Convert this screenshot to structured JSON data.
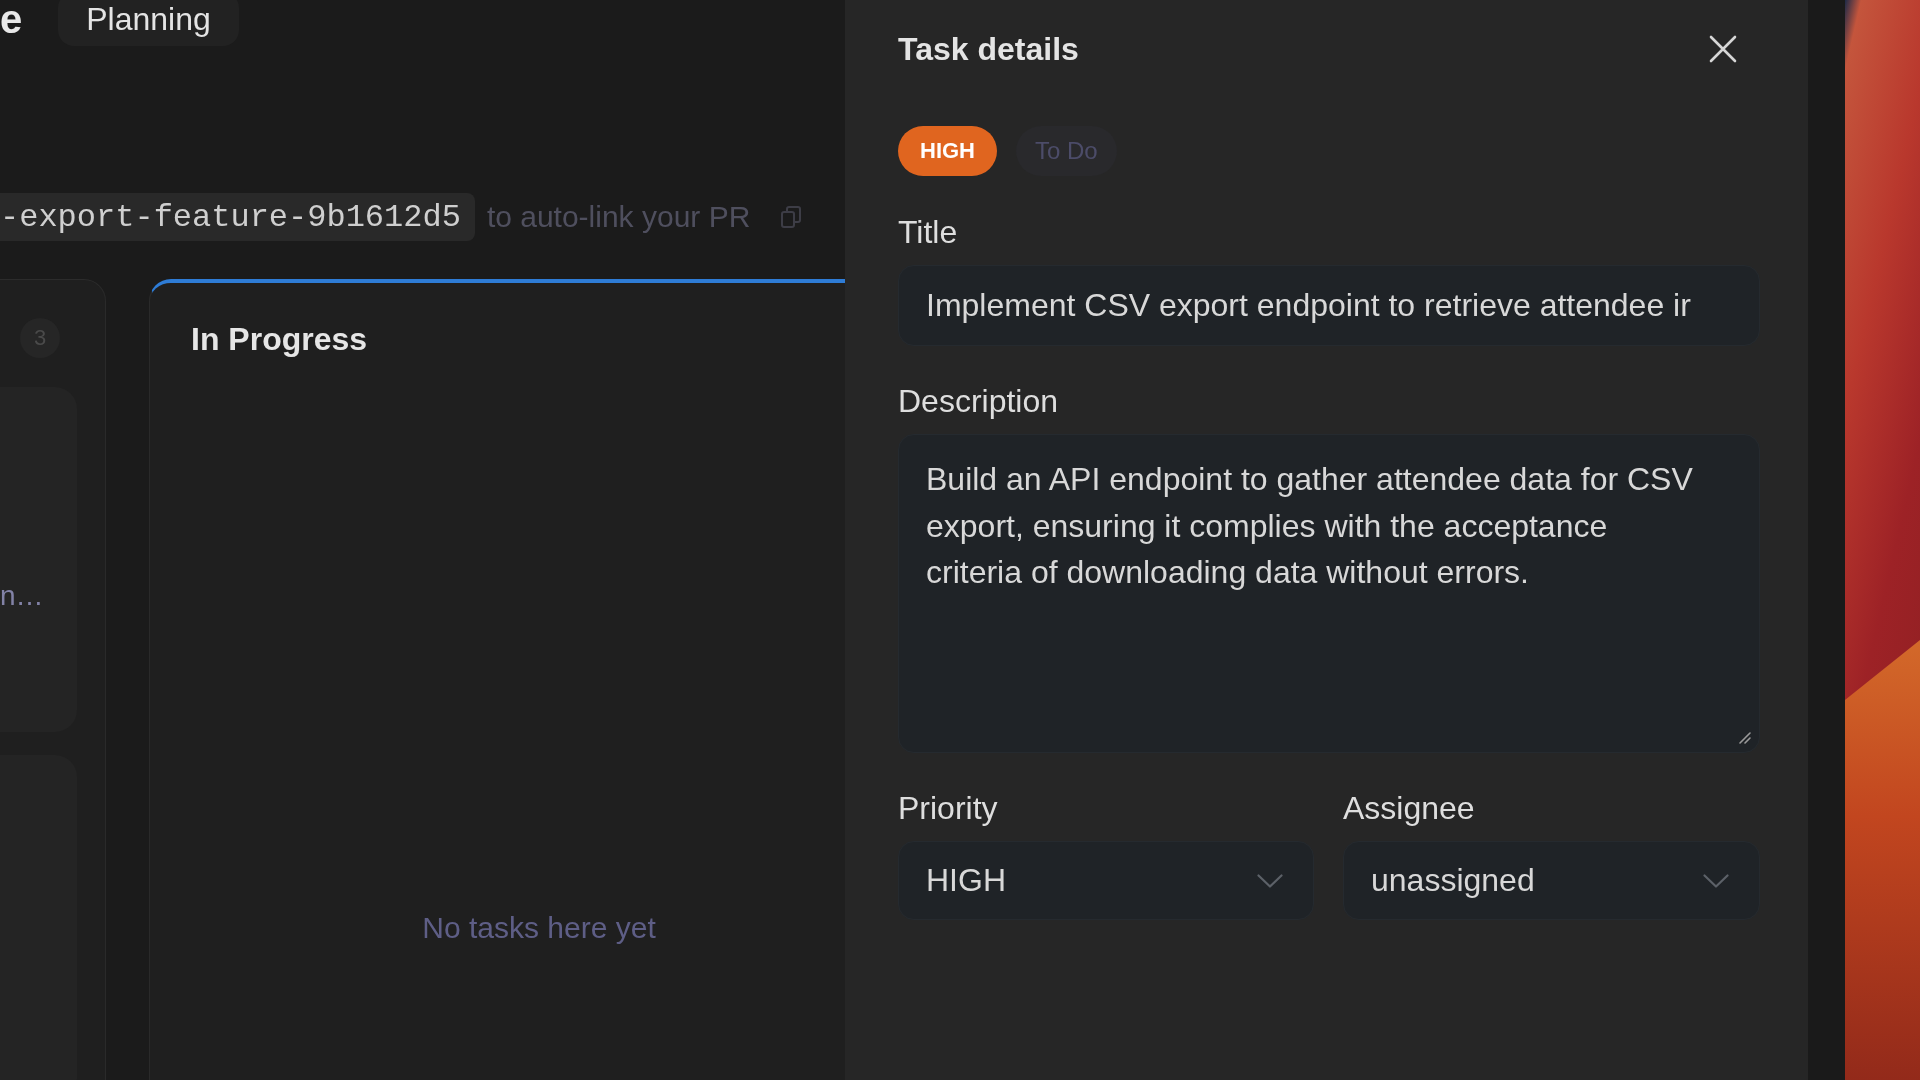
{
  "board": {
    "title": "e",
    "stage": "Planning",
    "branch": {
      "name": "-export-feature-9b1612d5",
      "hint": "to auto-link your PR"
    },
    "columns": [
      {
        "selected": false,
        "count": "3",
        "cards": [
          {
            "kind": "task",
            "text": "n…"
          },
          {
            "kind": "task"
          }
        ]
      },
      {
        "selected": true,
        "title": "In Progress",
        "empty_text": "No tasks here yet"
      }
    ]
  },
  "task_details": {
    "title": "Task details",
    "badges": [
      {
        "kind": "priority",
        "label": "HIGH"
      },
      {
        "kind": "status",
        "label": "To Do"
      }
    ],
    "fields": [
      {
        "kind": "input",
        "label": "Title",
        "value": "Implement CSV export endpoint to retrieve attendee ir"
      },
      {
        "kind": "textarea",
        "label": "Description",
        "value": "Build an API endpoint to gather attendee data for CSV export, ensuring it complies with the acceptance criteria of downloading data without errors."
      },
      {
        "kind": "select",
        "label": "Priority",
        "value": "HIGH"
      },
      {
        "kind": "select",
        "label": "Assignee",
        "value": "unassigned"
      }
    ]
  }
}
